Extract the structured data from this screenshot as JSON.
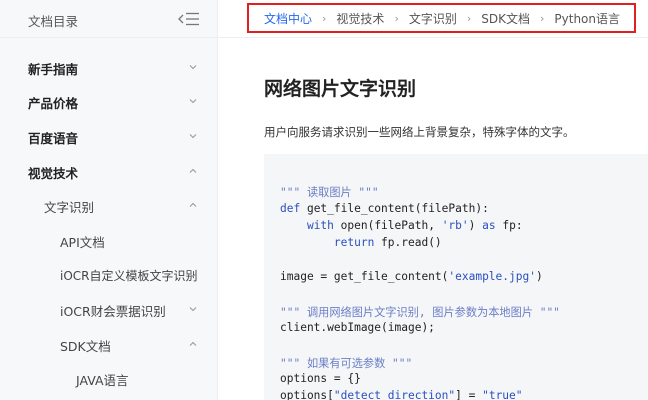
{
  "sidebar": {
    "title": "文档目录",
    "items": [
      {
        "label": "新手指南"
      },
      {
        "label": "产品价格"
      },
      {
        "label": "百度语音"
      },
      {
        "label": "视觉技术"
      },
      {
        "label": "文字识别"
      },
      {
        "label": "API文档"
      },
      {
        "label": "iOCR自定义模板文字识别"
      },
      {
        "label": "iOCR财会票据识别"
      },
      {
        "label": "SDK文档"
      },
      {
        "label": "JAVA语言"
      }
    ]
  },
  "breadcrumb": [
    "文档中心",
    "视觉技术",
    "文字识别",
    "SDK文档",
    "Python语言"
  ],
  "breadcrumb_separator": "›",
  "content": {
    "title": "网络图片文字识别",
    "description": "用户向服务请求识别一些网络上背景复杂，特殊字体的文字。",
    "code": {
      "l1": "\"\"\" 读取图片 \"\"\"",
      "l2_kw": "def",
      "l2_rest": " get_file_content(filePath):",
      "l3_kw": "with",
      "l3_a": " open(filePath, ",
      "l3_str": "'rb'",
      "l3_b": ") ",
      "l3_kw2": "as",
      "l3_c": " fp:",
      "l4_kw": "return",
      "l4_rest": " fp.read()",
      "l5_a": "image = get_file_content(",
      "l5_str": "'example.jpg'",
      "l5_b": ")",
      "l6": "\"\"\" 调用网络图片文字识别, 图片参数为本地图片 \"\"\"",
      "l7": "client.webImage(image);",
      "l8": "\"\"\" 如果有可选参数 \"\"\"",
      "l9": "options = {}",
      "l10_a": "options[",
      "l10_str": "\"detect_direction\"",
      "l10_b": "] = ",
      "l10_str2": "\"true\""
    }
  },
  "colors": {
    "accent": "#2468f2",
    "highlight_border": "#e02020",
    "sidebar_bg": "#f7f8fa",
    "code_bg": "#f5f6f8"
  },
  "icons": {
    "collapse": "menu-collapse-icon",
    "chevron_down": "chevron-down-icon",
    "chevron_up": "chevron-up-icon"
  }
}
